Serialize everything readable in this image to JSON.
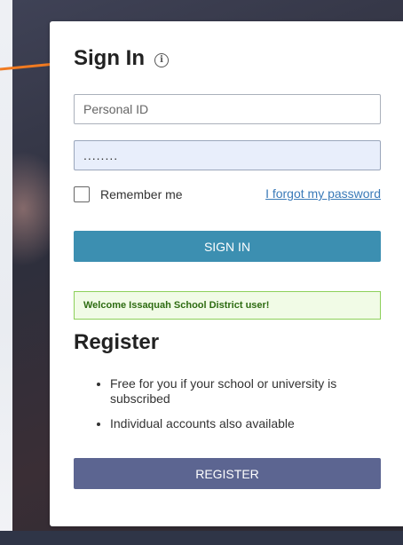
{
  "signin": {
    "title": "Sign In",
    "info_icon": "info-icon",
    "info_glyph": "i",
    "personal_id_placeholder": "Personal ID",
    "password_value": "........",
    "remember_label": "Remember me",
    "forgot_link": "I forgot my password",
    "button_label": "SIGN IN"
  },
  "welcome": {
    "message": "Welcome Issaquah School District user!"
  },
  "register": {
    "title": "Register",
    "items": [
      "Free for you if your school or university is subscribed",
      "Individual accounts also available"
    ],
    "button_label": "REGISTER"
  },
  "side_control": {
    "glyph": "‹"
  },
  "colors": {
    "signin_button": "#3c8fb1",
    "register_button": "#5c6591",
    "arrow": "#f07a21",
    "welcome_border": "#8dd05a",
    "link": "#3a7ab8"
  }
}
